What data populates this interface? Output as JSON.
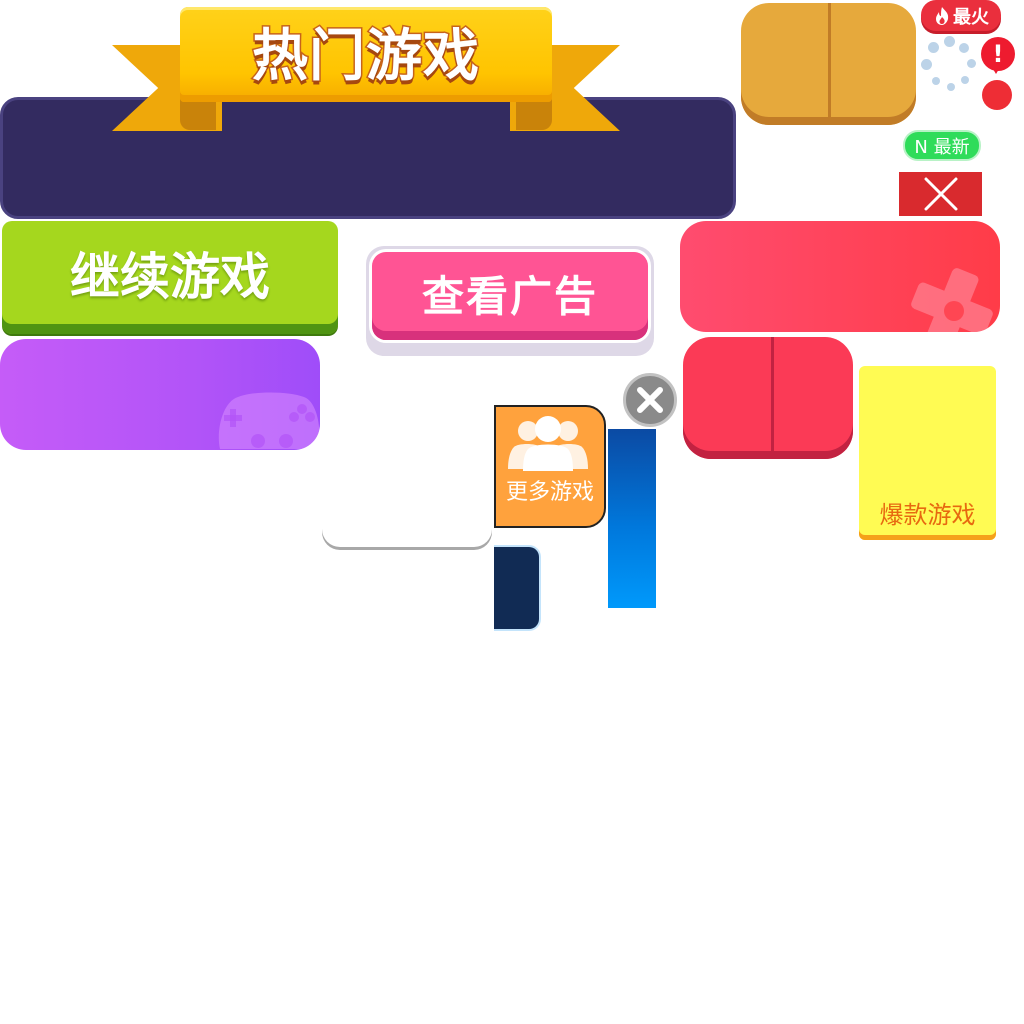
{
  "banner": {
    "title": "热门游戏"
  },
  "badges": {
    "hot": "最火",
    "hot_icon": "flame-icon",
    "new": "N 最新",
    "alert": "!"
  },
  "buttons": {
    "continue": "继续游戏",
    "watch_ad": "查看广告",
    "more_games": "更多游戏",
    "hit_games": "爆款游戏"
  },
  "colors": {
    "banner_panel": "#332b60",
    "ribbon": "#ffc400",
    "continue": "#a5d71e",
    "watch_ad": "#ff5494",
    "red_card": "#ff3c48",
    "purple_card": "#b254f8",
    "tan_button": "#e6a93c",
    "crimson_button": "#fb3a56",
    "more_games": "#ffa23d",
    "yellow_card": "#fffb53",
    "new_badge": "#2fdc5a",
    "close_square": "#d92a2e",
    "blue_bar": "#0099fb",
    "navy_tile": "#112b54"
  }
}
